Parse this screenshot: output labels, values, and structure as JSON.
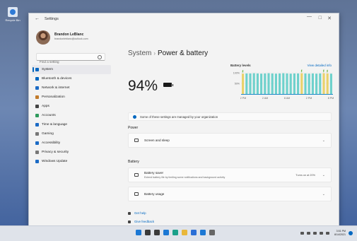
{
  "desktop": {
    "icon_label": "Recycle Bin"
  },
  "window": {
    "back": "←",
    "title": "Settings",
    "controls": {
      "minimize": "—",
      "maximize": "□",
      "close": "✕"
    }
  },
  "profile": {
    "name": "Brandon LeBlanc",
    "email": "brandonleblanc@outlook.com"
  },
  "search": {
    "placeholder": "Find a setting"
  },
  "nav": [
    {
      "label": "System",
      "icon": "monitor-icon",
      "color": "#0067c0",
      "active": true
    },
    {
      "label": "Bluetooth & devices",
      "icon": "bluetooth-icon",
      "color": "#0067c0"
    },
    {
      "label": "Network & internet",
      "icon": "wifi-icon",
      "color": "#1c6bc5"
    },
    {
      "label": "Personalization",
      "icon": "brush-icon",
      "color": "#c27b2b"
    },
    {
      "label": "Apps",
      "icon": "apps-icon",
      "color": "#444444"
    },
    {
      "label": "Accounts",
      "icon": "person-icon",
      "color": "#2f9a5c"
    },
    {
      "label": "Time & language",
      "icon": "globe-clock-icon",
      "color": "#1c6bc5"
    },
    {
      "label": "Gaming",
      "icon": "gamepad-icon",
      "color": "#777777"
    },
    {
      "label": "Accessibility",
      "icon": "accessibility-icon",
      "color": "#1c6bc5"
    },
    {
      "label": "Privacy & security",
      "icon": "shield-icon",
      "color": "#777777"
    },
    {
      "label": "Windows Update",
      "icon": "update-icon",
      "color": "#1c6bc5"
    }
  ],
  "breadcrumb": {
    "parent": "System",
    "separator": "›",
    "current": "Power & battery"
  },
  "battery": {
    "percent": "94%"
  },
  "levels": {
    "title": "Battery levels",
    "link": "View detailed info"
  },
  "chart_data": {
    "type": "bar",
    "title": "Battery levels",
    "x_tick_labels": [
      "2 PM",
      "2 AM",
      "8 AM",
      "2 PM",
      "8 PM"
    ],
    "y_tick_labels": [
      "100%",
      "50%"
    ],
    "ylim": [
      0,
      100
    ],
    "values": [
      96,
      97,
      97,
      98,
      97,
      96,
      97,
      98,
      97,
      96,
      97,
      98,
      97,
      96,
      97,
      97,
      98,
      97,
      96,
      97,
      96,
      97,
      98,
      97,
      96
    ],
    "charging_bar_indices": [
      0,
      16,
      22,
      23
    ],
    "colors": {
      "normal": "#6ed1cc",
      "charging": "#e9d26a",
      "baseline": "#1e88c8"
    }
  },
  "notice": {
    "text": "Some of these settings are managed by your organization"
  },
  "power_section": {
    "header": "Power",
    "screen_sleep": {
      "title": "Screen and sleep"
    }
  },
  "battery_section": {
    "header": "Battery",
    "saver": {
      "title": "Battery saver",
      "subtitle": "Extend battery life by limiting some notifications and background activity",
      "value": "Turns on at 20%"
    },
    "usage": {
      "title": "Battery usage"
    }
  },
  "help": {
    "get_help": "Get help",
    "feedback": "Give feedback"
  },
  "taskbar": {
    "icons": [
      {
        "name": "start-icon",
        "color": "#1c78d4"
      },
      {
        "name": "search-icon",
        "color": "#3a3a3a"
      },
      {
        "name": "task-view-icon",
        "color": "#3a3a3a"
      },
      {
        "name": "widgets-icon",
        "color": "#1c78d4"
      },
      {
        "name": "edge-icon",
        "color": "#1aa08a"
      },
      {
        "name": "file-explorer-icon",
        "color": "#e9b73a"
      },
      {
        "name": "store-icon",
        "color": "#2b6fd6"
      },
      {
        "name": "mail-icon",
        "color": "#1c78d4"
      },
      {
        "name": "settings-icon",
        "color": "#666666"
      }
    ],
    "time": "3:51 PM",
    "date": "8/14/2021"
  }
}
